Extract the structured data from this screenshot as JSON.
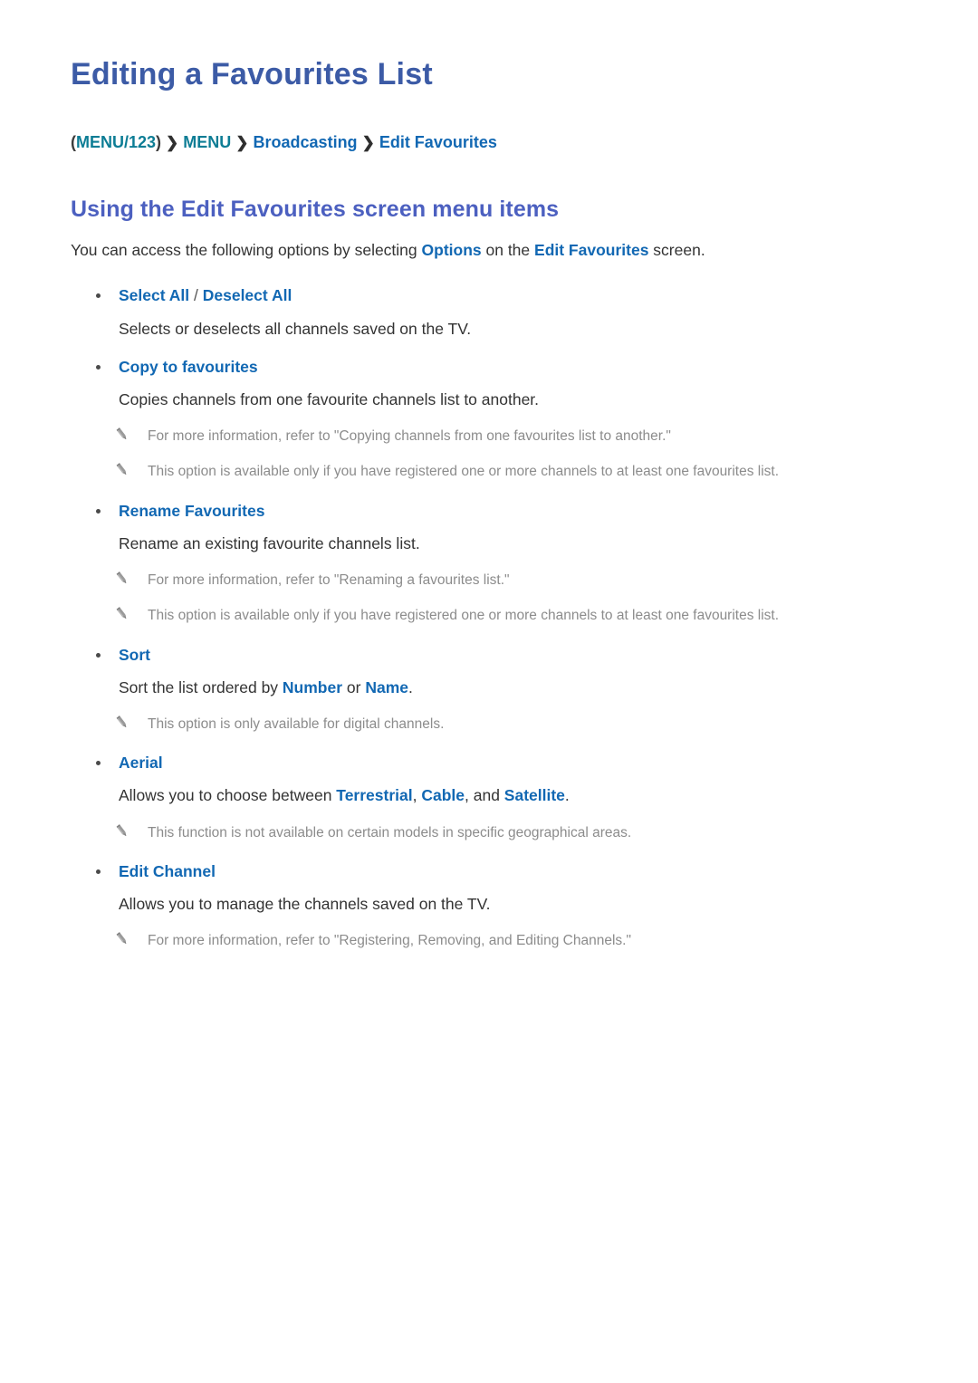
{
  "page": {
    "title": "Editing a Favourites List"
  },
  "breadcrumb": {
    "open_paren": "(",
    "item1": "MENU/123",
    "close_paren": ")",
    "sep": "❯",
    "item2": "MENU",
    "item3": "Broadcasting",
    "item4": "Edit Favourites"
  },
  "section": {
    "heading": "Using the Edit Favourites screen menu items",
    "intro": {
      "part1": "You can access the following options by selecting ",
      "kw1": "Options",
      "part2": " on the ",
      "kw2": "Edit Favourites",
      "part3": " screen."
    }
  },
  "options": [
    {
      "title_a": "Select All",
      "separator": " / ",
      "title_b": "Deselect All",
      "desc": "Selects or deselects all channels saved on the TV.",
      "notes": []
    },
    {
      "title_a": "Copy to favourites",
      "desc": "Copies channels from one favourite channels list to another.",
      "notes": [
        "For more information, refer to \"Copying channels from one favourites list to another.\"",
        "This option is available only if you have registered one or more channels to at least one favourites list."
      ]
    },
    {
      "title_a": "Rename Favourites",
      "desc": "Rename an existing favourite channels list.",
      "notes": [
        "For more information, refer to \"Renaming a favourites list.\"",
        "This option is available only if you have registered one or more channels to at least one favourites list."
      ]
    },
    {
      "title_a": "Sort",
      "desc_part1": "Sort the list ordered by ",
      "desc_kw1": "Number",
      "desc_part2": " or ",
      "desc_kw2": "Name",
      "desc_part3": ".",
      "notes": [
        "This option is only available for digital channels."
      ]
    },
    {
      "title_a": "Aerial",
      "desc_part1": "Allows you to choose between ",
      "desc_kw1": "Terrestrial",
      "desc_part2": ", ",
      "desc_kw2": "Cable",
      "desc_part3": ", and ",
      "desc_kw3": "Satellite",
      "desc_part4": ".",
      "notes": [
        "This function is not available on certain models in specific geographical areas."
      ]
    },
    {
      "title_a": "Edit Channel",
      "desc": "Allows you to manage the channels saved on the TV.",
      "notes": [
        "For more information, refer to \"Registering, Removing, and Editing Channels.\""
      ]
    }
  ],
  "icons": {
    "note": "pencil-icon",
    "bullet": "bullet-dot-icon",
    "breadcrumb_separator": "chevron-right-icon"
  },
  "colors": {
    "title_blue": "#3c5ba6",
    "heading_blue": "#4c60c0",
    "keyword_blue": "#1268b3",
    "breadcrumb_teal": "#0d7d95",
    "body_text": "#333333",
    "note_text": "#8c8c8c"
  }
}
